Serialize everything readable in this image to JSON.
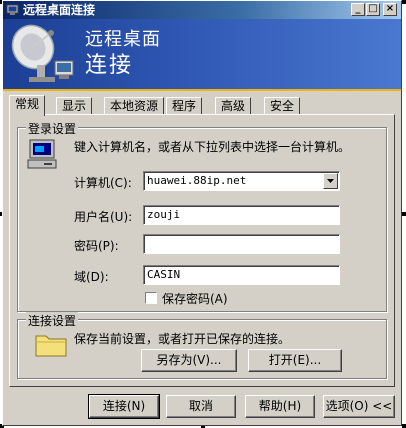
{
  "window": {
    "title": "远程桌面连接",
    "minimize_label": "_",
    "maximize_label": "□",
    "close_label": "×"
  },
  "banner": {
    "line1": "远程桌面",
    "line2": "连接"
  },
  "tabs": [
    {
      "label": "常规"
    },
    {
      "label": "显示"
    },
    {
      "label": "本地资源"
    },
    {
      "label": "程序"
    },
    {
      "label": "高级"
    },
    {
      "label": "安全"
    }
  ],
  "login_group": {
    "label": "登录设置",
    "instruction": "键入计算机名，或者从下拉列表中选择一台计算机。",
    "computer_label": "计算机(C):",
    "computer_value": "huawei.88ip.net",
    "username_label": "用户名(U):",
    "username_value": "zouji",
    "password_label": "密码(P):",
    "password_value": "",
    "domain_label": "域(D):",
    "domain_value": "CASIN",
    "save_password_label": "保存密码(A)",
    "save_password_checked": false
  },
  "connection_group": {
    "label": "连接设置",
    "instruction": "保存当前设置，或者打开已保存的连接。",
    "save_as_label": "另存为(V)...",
    "open_label": "打开(E)..."
  },
  "footer": {
    "connect_label": "连接(N)",
    "cancel_label": "取消",
    "help_label": "帮助(H)",
    "options_label": "选项(O) <<"
  }
}
